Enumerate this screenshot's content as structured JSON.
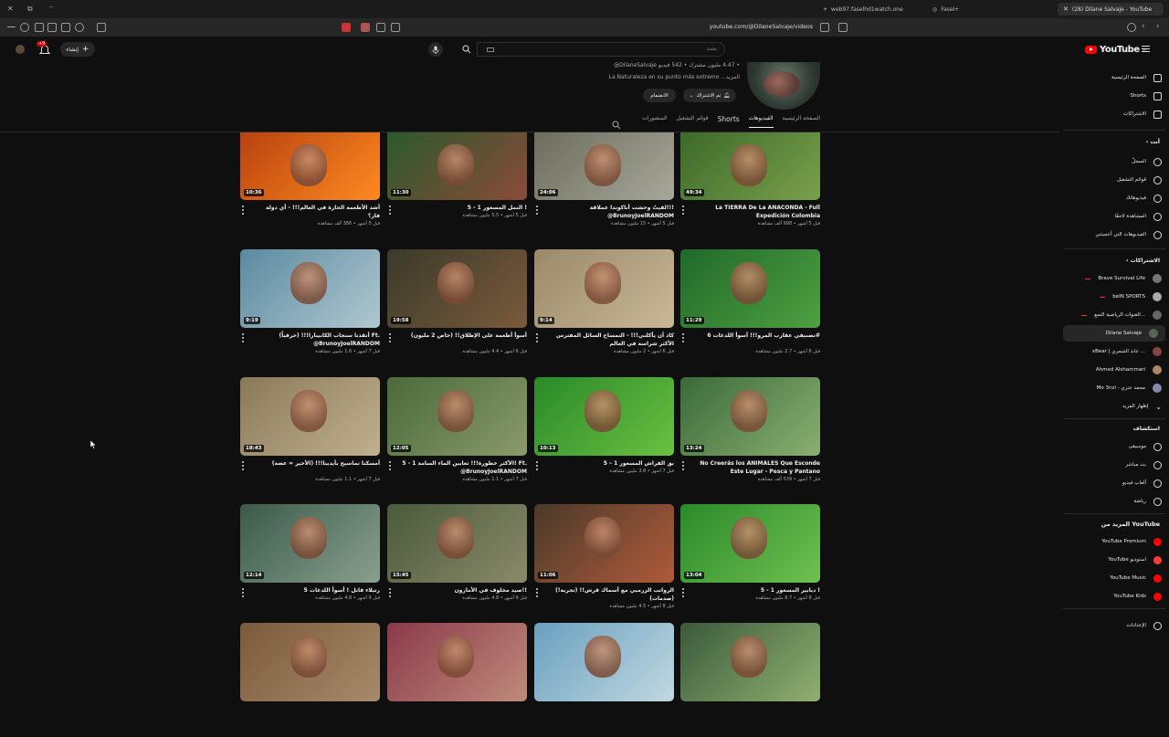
{
  "browser": {
    "tabs": [
      {
        "label": "(28) Dilane Salvaje - YouTube",
        "active": true
      },
      {
        "label": "Fasel+",
        "active": false
      },
      {
        "label": "web97.faselhd1watch.one",
        "active": false
      }
    ],
    "url": "youtube.com/@DilaneSalvaje/videos"
  },
  "masthead": {
    "logo_text": "YouTube",
    "logo_region": "SA",
    "search_placeholder": "بحث",
    "create_label": "إنشاء",
    "notif_count": "+9"
  },
  "channel": {
    "handle_line": "@DilaneSalvaje ‏• 4.47 مليون مشترك • 542 فيديو",
    "description": "La Naturaleza en su punto más extremo ...المزيد",
    "subscribe_label": "تم الاشتراك",
    "join_label": "الانضمام",
    "tabs": [
      "الصفحة الرئيسية",
      "الفيديوهات",
      "Shorts",
      "قوائم التشغيل",
      "المنشورات"
    ],
    "active_tab": "الفيديوهات"
  },
  "videos": [
    {
      "title": "La TIERRA De La ANACONDA - Full Expedición Colombia",
      "views": "998 ألف مشاهدة",
      "age": "قبل 5 أشهر",
      "duration": "49:34",
      "colors": [
        "#3b6a2a",
        "#7aa04a"
      ]
    },
    {
      "title": "لقيتُ وحشت أناكوندا عملاقة!!! ‎@BrunoyJoelRANDOM",
      "views": "15 مليون مشاهدة",
      "age": "قبل 5 أشهر",
      "duration": "24:06",
      "colors": [
        "#6d6d5d",
        "#a8a89a"
      ]
    },
    {
      "title": "النمل المسعور 1 - 5 !",
      "views": "5.5 مليون مشاهدة",
      "age": "قبل 5 أشهر",
      "duration": "11:30",
      "colors": [
        "#2a5a2a",
        "#8a4a3a"
      ]
    },
    {
      "title": "أشد الأطعمة الحارة في العالم!!! - أي دولة فاز؟",
      "views": "386 ألف مشاهدة",
      "age": "قبل 5 أشهر",
      "duration": "10:36",
      "colors": [
        "#b8420f",
        "#ff8a20"
      ]
    },
    {
      "title": "تصنيفي عقارب المرو!!! أسوأ اللدغات 6#",
      "views": "2.7 مليون مشاهدة",
      "age": "قبل 6 أشهر",
      "duration": "11:29",
      "colors": [
        "#1f6a2a",
        "#4fa040"
      ]
    },
    {
      "title": "كاد أن يأكلني!!! - التمساح السائل المفترس الأكثر شراسة في العالم",
      "views": "2 مليون مشاهدة",
      "age": "قبل 6 أشهر",
      "duration": "9:14",
      "colors": [
        "#9a8a6a",
        "#c8b896"
      ]
    },
    {
      "title": "أسوأ أطعمة على الإطلاق!! (خاص 2 مليون)",
      "views": "4.4 مليون مشاهدة",
      "age": "قبل 6 أشهر",
      "duration": "19:58",
      "colors": [
        "#3a3a2a",
        "#7a5a3a"
      ]
    },
    {
      "title": "أنقذنا سنجاب الكابيبارا!!! (حرفياً) ‎Ft. @BrunoyJoelRANDOM",
      "views": "1.6 مليون مشاهدة",
      "age": "قبل 7 أشهر",
      "duration": "9:19",
      "colors": [
        "#5a8aa0",
        "#b0c8d0"
      ]
    },
    {
      "title": "No Creerás los ANIMALES Que Esconde Este Lugar - Pesca y Pantano",
      "views": "539 ألف مشاهدة",
      "age": "قبل 7 أشهر",
      "duration": "13:24",
      "colors": [
        "#3a6a3a",
        "#8ab070"
      ]
    },
    {
      "title": "بق الفراش المسعور 1 – 5",
      "views": "3.8 مليون مشاهدة",
      "age": "قبل 7 أشهر",
      "duration": "10:13",
      "colors": [
        "#2a8a2a",
        "#6ac040"
      ]
    },
    {
      "title": "الأكثر خطورة!!! ثعابين الماء السامة 1 - 5! ‎Ft. @BrunoyJoelRANDOM",
      "views": "1.1 مليون مشاهدة",
      "age": "قبل 7 أشهر",
      "duration": "12:05",
      "colors": [
        "#4a6a3a",
        "#8a9a6a"
      ]
    },
    {
      "title": "أمسكنا تماسيح بأيدينا!!! (الأخير = عضة)",
      "views": "1.1 مليون مشاهدة",
      "age": "قبل 7 أشهر",
      "duration": "18:43",
      "colors": [
        "#8a7a5a",
        "#c0b090"
      ]
    },
    {
      "title": "دبابير المسعور 1 - 5 !",
      "views": "8.7 مليون مشاهدة",
      "age": "قبل 8 أشهر",
      "duration": "13:04",
      "colors": [
        "#2a8a2a",
        "#70c050"
      ]
    },
    {
      "title": "الرواتب الزرمبي مع أسماك قرش!! (تجربة!) (صدمات)",
      "views": "4.5 مليون مشاهدة",
      "age": "قبل 8 أشهر",
      "duration": "11:06",
      "colors": [
        "#4a3a2a",
        "#b05a3a"
      ]
    },
    {
      "title": "صيد مخلوف في الأمازون!!",
      "views": "4.8 مليون مشاهدة",
      "age": "قبل 9 أشهر",
      "duration": "15:45",
      "colors": [
        "#4a5a3a",
        "#8a8a6a"
      ]
    },
    {
      "title": "رتيلاء قاتل ! أسوأ اللدغات 5",
      "views": "4.8 مليون مشاهدة",
      "age": "قبل 9 أشهر",
      "duration": "12:14",
      "colors": [
        "#3a5a4a",
        "#8aa090"
      ]
    },
    {
      "title": "",
      "views": "",
      "age": "",
      "duration": "",
      "colors": [
        "#3a5a3a",
        "#90b070"
      ]
    },
    {
      "title": "",
      "views": "",
      "age": "",
      "duration": "",
      "colors": [
        "#6aa0c0",
        "#c0d8e0"
      ]
    },
    {
      "title": "",
      "views": "",
      "age": "",
      "duration": "",
      "colors": [
        "#8a3a4a",
        "#c08a7a"
      ]
    },
    {
      "title": "",
      "views": "",
      "age": "",
      "duration": "",
      "colors": [
        "#7a5a3a",
        "#a88a6a"
      ]
    }
  ],
  "sidebar": {
    "main": [
      {
        "label": "الصفحة الرئيسية",
        "icon": "home-icon"
      },
      {
        "label": "Shorts",
        "icon": "shorts-icon"
      },
      {
        "label": "الاشتراكات",
        "icon": "subscriptions-icon"
      }
    ],
    "you_header": "أنت",
    "you": [
      {
        "label": "السجلّ",
        "icon": "history-icon"
      },
      {
        "label": "قوائم التشغيل",
        "icon": "playlists-icon"
      },
      {
        "label": "فيديوهاتك",
        "icon": "your-videos-icon"
      },
      {
        "label": "المشاهدة لاحقًا",
        "icon": "watch-later-icon"
      },
      {
        "label": "الفيديوهات التي أعجبتني",
        "icon": "liked-icon"
      }
    ],
    "subs_header": "الاشتراكات",
    "subs": [
      {
        "label": "Brave Survival Life",
        "live": true,
        "color": "#777"
      },
      {
        "label": "beIN SPORTS",
        "live": true,
        "color": "#aaa"
      },
      {
        "label": "القنوات الرياضية السع...",
        "live": true,
        "color": "#666"
      },
      {
        "label": "Dilane Salvaje",
        "live": false,
        "color": "#556655",
        "active": true
      },
      {
        "label": "xBear | عابد الشمري ...",
        "live": false,
        "color": "#884444"
      },
      {
        "label": "Ahmed Alshammari",
        "live": false,
        "color": "#aa8866"
      },
      {
        "label": "Mo 3nzi - محمد عنزي",
        "live": false,
        "color": "#8888aa"
      }
    ],
    "show_more": "إظهار المزيد",
    "explore_header": "استكشاف",
    "explore": [
      {
        "label": "موسيقى",
        "icon": "music-icon"
      },
      {
        "label": "بث مباشر",
        "icon": "live-icon"
      },
      {
        "label": "ألعاب فيديو",
        "icon": "gaming-icon"
      },
      {
        "label": "رياضة",
        "icon": "trophy-icon"
      }
    ],
    "more_header": "المزيد من YouTube",
    "more": [
      {
        "label": "YouTube Premium",
        "color": "#ff0000"
      },
      {
        "label": "YouTube استوديو",
        "color": "#ff3a3a"
      },
      {
        "label": "YouTube Music",
        "color": "#ff0000"
      },
      {
        "label": "YouTube Kids",
        "color": "#ff0000"
      }
    ],
    "settings": "الإعدادات"
  }
}
